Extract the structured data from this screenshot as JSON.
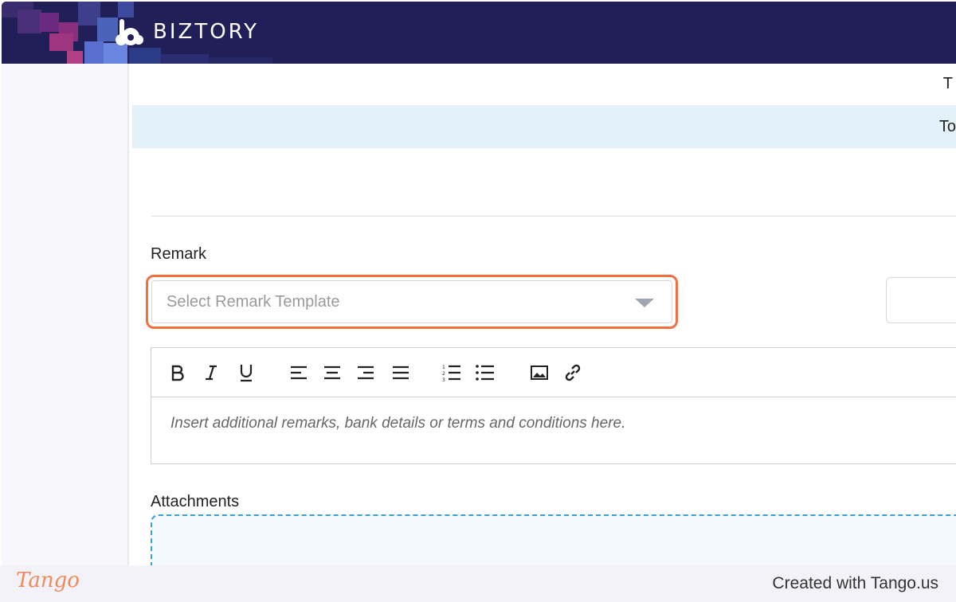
{
  "header": {
    "brand": "BIZTORY"
  },
  "content": {
    "top_row_text": "T",
    "blue_row_text": "To",
    "remark": {
      "label": "Remark",
      "template_placeholder": "Select Remark Template"
    },
    "editor": {
      "placeholder": "Insert additional remarks, bank details or terms and conditions here.",
      "toolbar": [
        "bold-icon",
        "italic-icon",
        "underline-icon",
        "align-left-icon",
        "align-center-icon",
        "align-right-icon",
        "justify-icon",
        "numbered-list-icon",
        "bullet-list-icon",
        "image-icon",
        "link-icon"
      ]
    },
    "attachments": {
      "label": "Attachments"
    }
  },
  "footer": {
    "logo": "Tango",
    "credit": "Created with Tango.us"
  },
  "colors": {
    "header_bg": "#201f57",
    "highlight": "#f26f3f",
    "dropzone_border": "#3aa0cf",
    "row_blue": "#e3f1f8"
  }
}
